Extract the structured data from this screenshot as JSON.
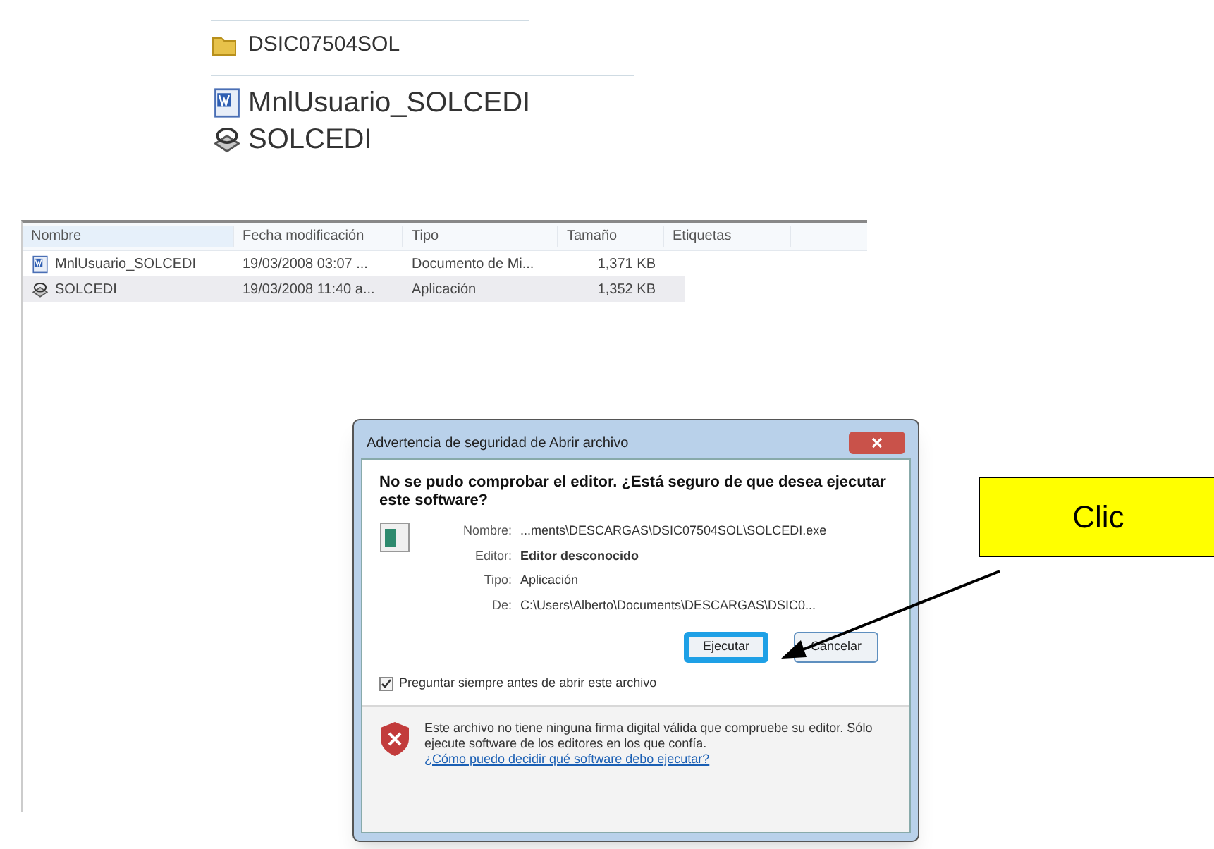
{
  "folder_listing": {
    "folder": "DSIC07504SOL",
    "files": [
      {
        "name": "MnlUsuario_SOLCEDI",
        "kind": "document"
      },
      {
        "name": "SOLCEDI",
        "kind": "application"
      }
    ]
  },
  "explorer": {
    "columns": [
      "Nombre",
      "Fecha modificación",
      "Tipo",
      "Tamaño",
      "Etiquetas"
    ],
    "rows": [
      {
        "kind": "document",
        "selected": false,
        "cells": [
          "MnlUsuario_SOLCEDI",
          "19/03/2008 03:07 ...",
          "Documento de Mi...",
          "1,371 KB"
        ]
      },
      {
        "kind": "application",
        "selected": true,
        "cells": [
          "SOLCEDI",
          "19/03/2008 11:40 a...",
          "Aplicación",
          "1,352 KB"
        ]
      }
    ]
  },
  "dialog": {
    "title": "Advertencia de seguridad de Abrir archivo",
    "heading": "No se pudo comprobar el editor. ¿Está seguro de que desea ejecutar este software?",
    "fields": [
      {
        "label": "Nombre:",
        "value": "...ments\\DESCARGAS\\DSIC07504SOL\\SOLCEDI.exe",
        "bold": false
      },
      {
        "label": "Editor:",
        "value": "Editor desconocido",
        "bold": true
      },
      {
        "label": "Tipo:",
        "value": "Aplicación",
        "bold": false
      },
      {
        "label": "De:",
        "value": "C:\\Users\\Alberto\\Documents\\DESCARGAS\\DSIC0...",
        "bold": false
      }
    ],
    "buttons": [
      {
        "label": "Ejecutar",
        "highlighted": true
      },
      {
        "label": "Cancelar",
        "highlighted": false
      }
    ],
    "checkbox": {
      "label": "Preguntar siempre antes de abrir este archivo",
      "checked": true
    },
    "warning": "Este archivo no tiene ninguna firma digital válida que compruebe su editor. Sólo ejecute software de los editores en los que confía.",
    "link": "¿Cómo puedo decidir qué software debo ejecutar?"
  },
  "callout": {
    "text": "Clic"
  }
}
